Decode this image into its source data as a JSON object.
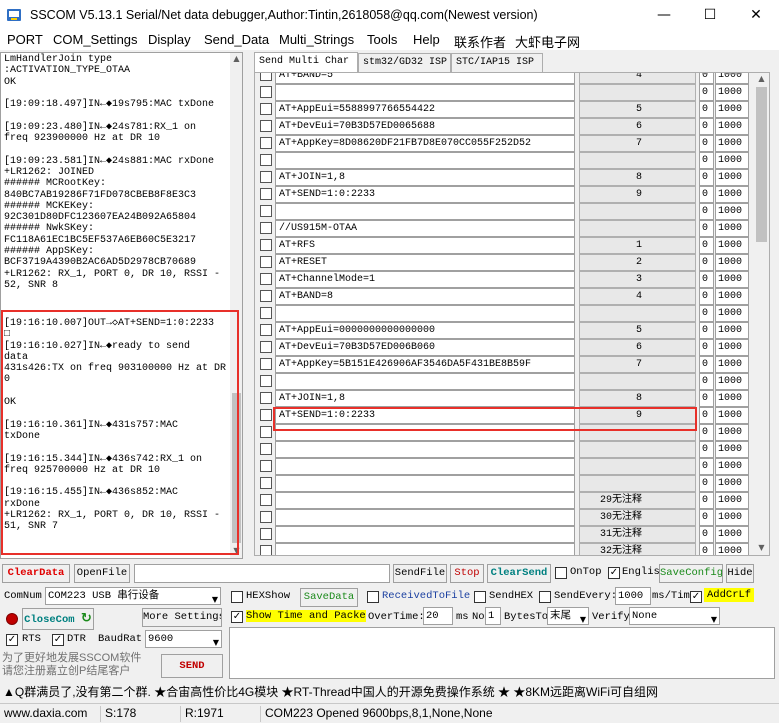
{
  "window": {
    "title": "SSCOM V5.13.1 Serial/Net data debugger,Author:Tintin,2618058@qq.com(Newest version)",
    "minimize": "—",
    "maximize": "☐",
    "close": "✕"
  },
  "menu": [
    "PORT",
    "COM_Settings",
    "Display",
    "Send_Data",
    "Multi_Strings",
    "Tools",
    "Help",
    "联系作者",
    "大虾电子网"
  ],
  "log": {
    "top_lines": [
      "LmHandlerJoin type",
      ":ACTIVATION_TYPE_OTAA",
      "OK",
      "",
      "[19:09:18.497]IN←◆19s795:MAC txDone",
      "",
      "[19:09:23.480]IN←◆24s781:RX_1 on",
      "freq 923900000 Hz at DR 10",
      "",
      "[19:09:23.581]IN←◆24s881:MAC rxDone",
      "+LR1262: JOINED",
      "###### MCRootKey:",
      "840BC7AB19286F71FD078CBEB8F8E3C3",
      "###### MCKEKey:",
      "92C301D80DFC123607EA24B092A65804",
      "###### NwkSKey:",
      "FC118A61EC1BC5EF537A6EB60C5E3217",
      "###### AppSKey:",
      "BCF3719A4390B2AC6AD5D2978CB70689",
      "+LR1262: RX_1, PORT 0, DR 10, RSSI -",
      "52, SNR 8"
    ],
    "bottom_lines": [
      "[19:16:10.007]OUT→◇AT+SEND=1:0:2233",
      "□",
      "[19:16:10.027]IN←◆ready to send",
      "data",
      "431s426:TX on freq 903100000 Hz at DR",
      "0",
      "",
      "OK",
      "",
      "[19:16:10.361]IN←◆431s757:MAC",
      "txDone",
      "",
      "[19:16:15.344]IN←◆436s742:RX_1 on",
      "freq 925700000 Hz at DR 10",
      "",
      "[19:16:15.455]IN←◆436s852:MAC",
      "rxDone",
      "+LR1262: RX_1, PORT 0, DR 10, RSSI -",
      "51, SNR 7"
    ]
  },
  "tabs": [
    "Send Multi Char",
    "stm32/GD32 ISP",
    "STC/IAP15 ISP"
  ],
  "multi_rows": [
    {
      "cmd": "AT+BAND=5",
      "btn": "4",
      "n": "0",
      "d": "1000"
    },
    {
      "cmd": "",
      "btn": "",
      "n": "0",
      "d": "1000"
    },
    {
      "cmd": "AT+AppEui=5588997766554422",
      "btn": "5",
      "n": "0",
      "d": "1000"
    },
    {
      "cmd": "AT+DevEui=70B3D57ED0065688",
      "btn": "6",
      "n": "0",
      "d": "1000"
    },
    {
      "cmd": "AT+AppKey=8D08620DF21FB7D8E070CC055F252D52",
      "btn": "7",
      "n": "0",
      "d": "1000"
    },
    {
      "cmd": "",
      "btn": "",
      "n": "0",
      "d": "1000"
    },
    {
      "cmd": "AT+JOIN=1,8",
      "btn": "8",
      "n": "0",
      "d": "1000"
    },
    {
      "cmd": "AT+SEND=1:0:2233",
      "btn": "9",
      "n": "0",
      "d": "1000"
    },
    {
      "cmd": "",
      "btn": "",
      "n": "0",
      "d": "1000"
    },
    {
      "cmd": "//US915M-OTAA",
      "btn": "",
      "n": "0",
      "d": "1000"
    },
    {
      "cmd": "AT+RFS",
      "btn": "1",
      "n": "0",
      "d": "1000"
    },
    {
      "cmd": "AT+RESET",
      "btn": "2",
      "n": "0",
      "d": "1000"
    },
    {
      "cmd": "AT+ChannelMode=1",
      "btn": "3",
      "n": "0",
      "d": "1000"
    },
    {
      "cmd": "AT+BAND=8",
      "btn": "4",
      "n": "0",
      "d": "1000"
    },
    {
      "cmd": "",
      "btn": "",
      "n": "0",
      "d": "1000"
    },
    {
      "cmd": "AT+AppEui=0000000000000000",
      "btn": "5",
      "n": "0",
      "d": "1000"
    },
    {
      "cmd": "AT+DevEui=70B3D57ED006B060",
      "btn": "6",
      "n": "0",
      "d": "1000"
    },
    {
      "cmd": "AT+AppKey=5B151E426906AF3546DA5F431BE8B59F",
      "btn": "7",
      "n": "0",
      "d": "1000"
    },
    {
      "cmd": "",
      "btn": "",
      "n": "0",
      "d": "1000"
    },
    {
      "cmd": "AT+JOIN=1,8",
      "btn": "8",
      "n": "0",
      "d": "1000"
    },
    {
      "cmd": "AT+SEND=1:0:2233",
      "btn": "9",
      "n": "0",
      "d": "1000"
    },
    {
      "cmd": "",
      "btn": "",
      "n": "0",
      "d": "1000"
    },
    {
      "cmd": "",
      "btn": "",
      "n": "0",
      "d": "1000"
    },
    {
      "cmd": "",
      "btn": "",
      "n": "0",
      "d": "1000"
    },
    {
      "cmd": "",
      "btn": "",
      "n": "0",
      "d": "1000"
    },
    {
      "cmd": "",
      "btn": "29无注释",
      "n": "0",
      "d": "1000"
    },
    {
      "cmd": "",
      "btn": "30无注释",
      "n": "0",
      "d": "1000"
    },
    {
      "cmd": "",
      "btn": "31无注释",
      "n": "0",
      "d": "1000"
    },
    {
      "cmd": "",
      "btn": "32无注释",
      "n": "0",
      "d": "1000"
    }
  ],
  "toolbar": {
    "clear_data": "ClearData",
    "open_file": "OpenFile",
    "send_file": "SendFile",
    "stop": "Stop",
    "clear_send": "ClearSend",
    "on_top": "OnTop",
    "english": "English",
    "save_config": "SaveConfig",
    "hide": "Hide"
  },
  "port": {
    "comnum_label": "ComNum",
    "com_value": "COM223 USB 串行设备",
    "close_com": "CloseCom",
    "more_settings": "More Settings",
    "rts": "RTS",
    "dtr": "DTR",
    "baud_label": "BaudRat",
    "baud_value": "9600",
    "promo": "为了更好地发展SSCOM软件\n请您注册嘉立创P结尾客户",
    "send": "SEND"
  },
  "options": {
    "hexshow": "HEXShow",
    "savedata": "SaveData",
    "received_to_file": "ReceivedToFile",
    "sendhex": "SendHEX",
    "send_every": "SendEvery:",
    "interval": "1000",
    "ms_tim": "ms/Tim",
    "add_crlf": "AddCrLf",
    "show_time": "Show Time and Packe",
    "overtime": "OverTime:",
    "overtime_val": "20",
    "ms": "ms",
    "no": "No",
    "no_val": "1",
    "bytes_to": "BytesTo",
    "end_value": "末尾",
    "verify": "Verify",
    "verify_value": "None"
  },
  "ticker": "▲Q群满员了,没有第二个群. ★合宙高性价比4G模块 ★RT-Thread中国人的开源免费操作系统 ★ ★8KM远距离WiFi可自组网",
  "status": {
    "site": "www.daxia.com",
    "s": "S:178",
    "r": "R:1971",
    "port": "COM223 Opened  9600bps,8,1,None,None"
  },
  "colors": {
    "highlight": "#e8302a",
    "accent_red": "#e00000",
    "accent_green": "#1a8a1a",
    "addcrlf_bg": "#ffff00"
  }
}
